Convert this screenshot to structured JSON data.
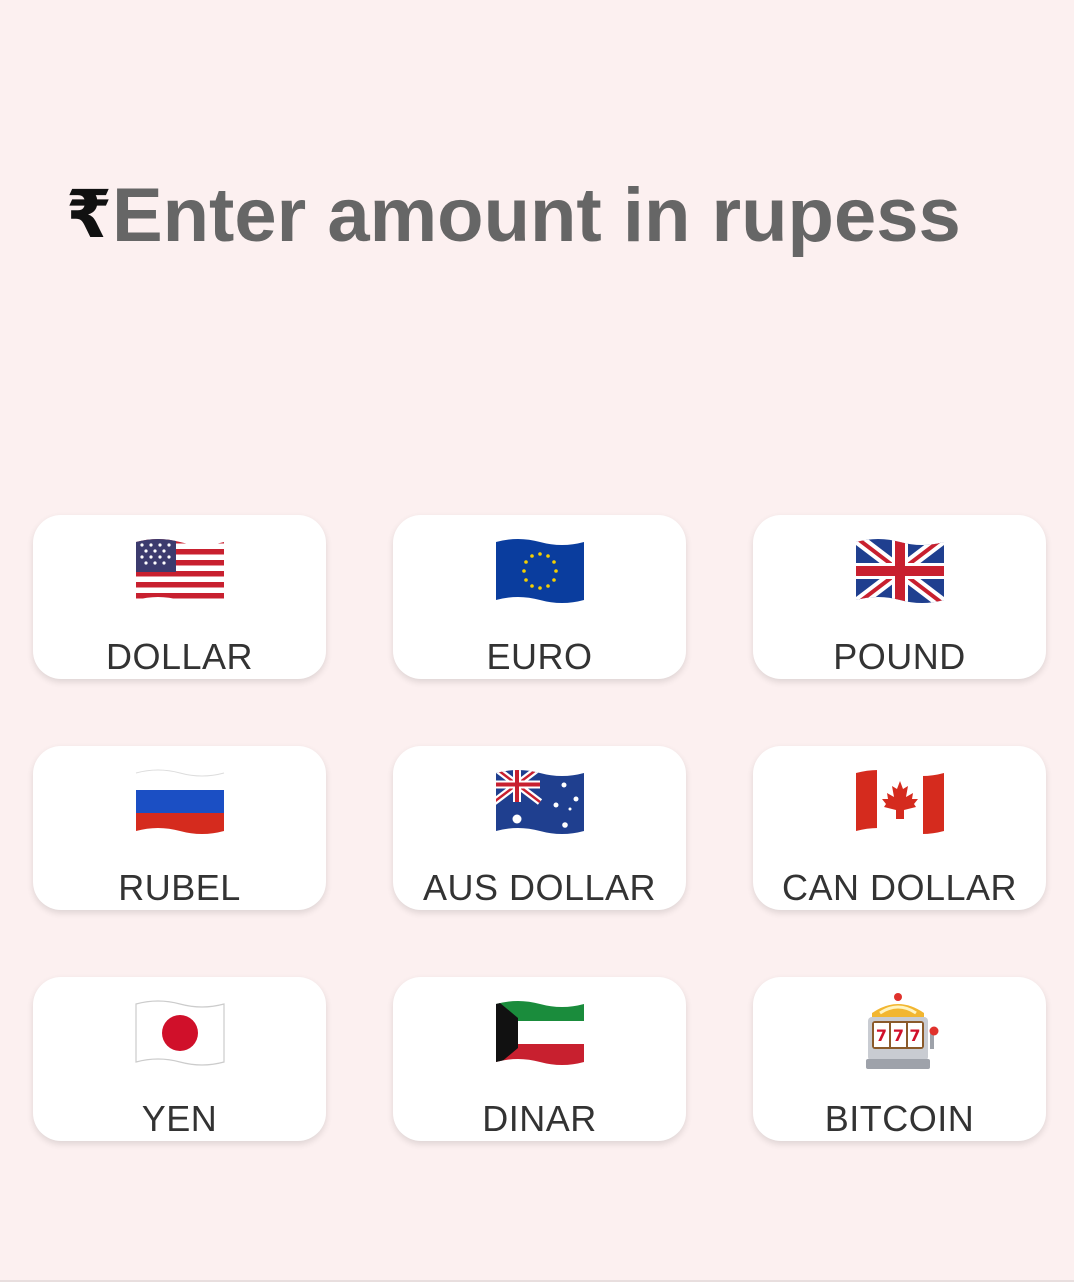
{
  "amount": {
    "currency_symbol": "₹",
    "currency_icon": "rupee-icon",
    "placeholder": "Enter amount in rupess",
    "value": ""
  },
  "currencies": [
    {
      "label": "DOLLAR",
      "icon": "us-flag-icon"
    },
    {
      "label": "EURO",
      "icon": "eu-flag-icon"
    },
    {
      "label": "POUND",
      "icon": "uk-flag-icon"
    },
    {
      "label": "RUBEL",
      "icon": "russia-flag-icon"
    },
    {
      "label": "AUS DOLLAR",
      "icon": "australia-flag-icon"
    },
    {
      "label": "CAN DOLLAR",
      "icon": "canada-flag-icon"
    },
    {
      "label": "YEN",
      "icon": "japan-flag-icon"
    },
    {
      "label": "DINAR",
      "icon": "kuwait-flag-icon"
    },
    {
      "label": "BITCOIN",
      "icon": "slot-machine-icon"
    }
  ],
  "colors": {
    "background": "#fcf0f0",
    "card": "#ffffff",
    "label_text": "#333333",
    "placeholder_text": "#666666"
  }
}
